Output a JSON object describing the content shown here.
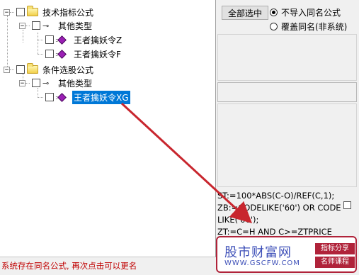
{
  "tree": {
    "items": [
      {
        "label": "技术指标公式"
      },
      {
        "label": "其他类型"
      },
      {
        "label": "王者擒妖令Z"
      },
      {
        "label": "王者擒妖令F"
      },
      {
        "label": "条件选股公式"
      },
      {
        "label": "其他类型"
      },
      {
        "label": "王者擒妖令XG"
      }
    ],
    "expander_open": "−"
  },
  "options": {
    "select_all_label": "全部选中",
    "radio_skip_label": "不导入同名公式",
    "radio_overwrite_label": "覆盖同名(非系统)"
  },
  "code": {
    "text": "ST:=100*ABS(C-O)/REF(C,1);\nZB:=CODELIKE('60') OR CODELIKE('00');\nZT:=C=H AND C>=ZTPRICE"
  },
  "status": {
    "message": "系统存在同名公式, 再次点击可以更名"
  },
  "watermark": {
    "brand": "股市财富网",
    "url": "WWW.GSCFW.COM",
    "tag1": "指标分享",
    "tag2": "名师课程"
  },
  "colors": {
    "selection": "#0078d7",
    "status_text": "#c00000",
    "arrow": "#c8262e",
    "watermark_border": "#b0233a",
    "watermark_text": "#3d4fb8"
  }
}
